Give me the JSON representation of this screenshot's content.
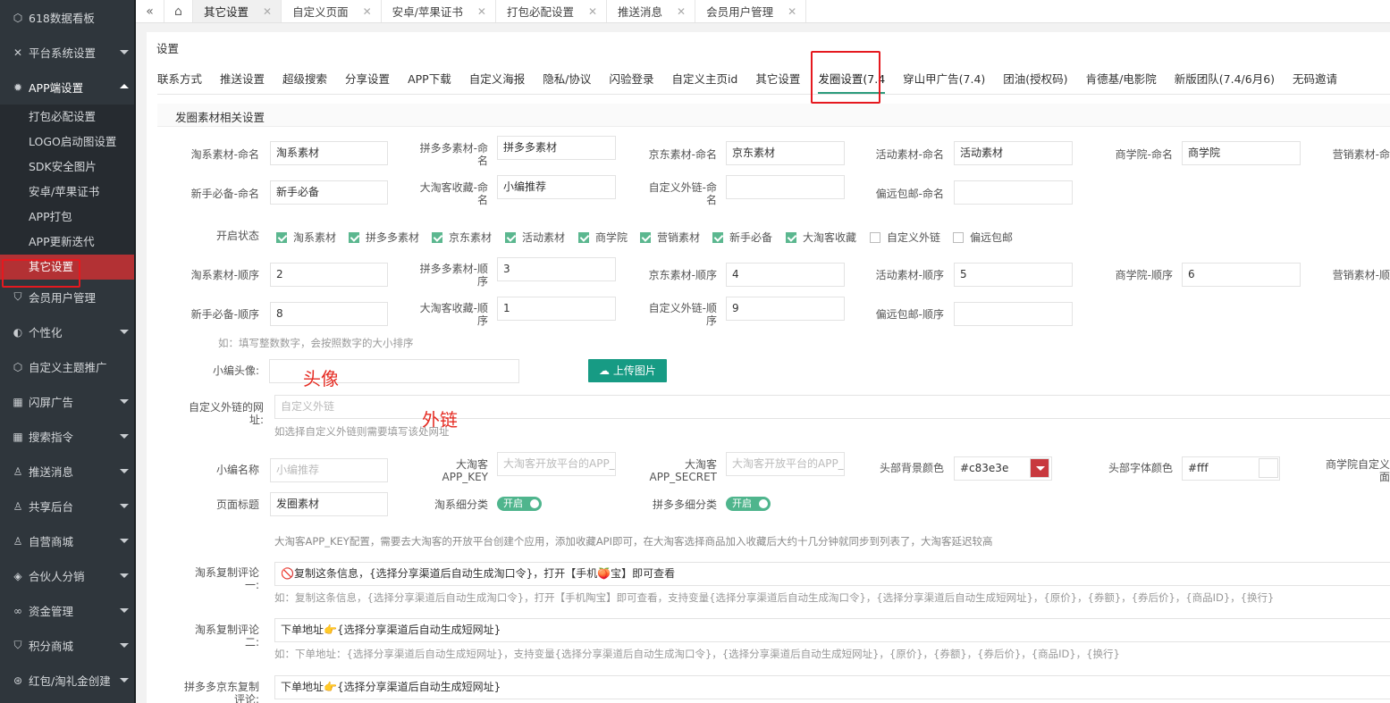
{
  "sidebar": {
    "items": [
      {
        "icon": "cube-icon",
        "label": "618数据看板",
        "caret": false
      },
      {
        "icon": "tools-icon",
        "label": "平台系统设置",
        "caret": true
      },
      {
        "icon": "gear-icon",
        "label": "APP端设置",
        "caret": true,
        "open": true
      },
      {
        "icon": "shield-icon",
        "label": "会员用户管理",
        "caret": false
      },
      {
        "icon": "palette-icon",
        "label": "个性化",
        "caret": true
      },
      {
        "icon": "cube-icon",
        "label": "自定义主题推广",
        "caret": false
      },
      {
        "icon": "grid-icon",
        "label": "闪屏广告",
        "caret": true
      },
      {
        "icon": "grid-icon",
        "label": "搜索指令",
        "caret": true
      },
      {
        "icon": "user-icon",
        "label": "推送消息",
        "caret": true
      },
      {
        "icon": "user-icon",
        "label": "共享后台",
        "caret": true
      },
      {
        "icon": "user-icon",
        "label": "自营商城",
        "caret": true
      },
      {
        "icon": "layers-icon",
        "label": "合伙人分销",
        "caret": true
      },
      {
        "icon": "link-icon",
        "label": "资金管理",
        "caret": true
      },
      {
        "icon": "shield-icon",
        "label": "积分商城",
        "caret": true
      },
      {
        "icon": "gift-icon",
        "label": "红包/淘礼金创建",
        "caret": true
      }
    ],
    "sub_items": [
      "打包必配设置",
      "LOGO启动图设置",
      "SDK安全图片",
      "安卓/苹果证书",
      "APP打包",
      "APP更新迭代",
      "其它设置"
    ]
  },
  "tabbar": {
    "tabs": [
      "其它设置",
      "自定义页面",
      "安卓/苹果证书",
      "打包必配设置",
      "推送消息",
      "会员用户管理"
    ],
    "active": 0
  },
  "panel": {
    "title": "设置",
    "subtabs": [
      "联系方式",
      "推送设置",
      "超级搜索",
      "分享设置",
      "APP下载",
      "自定义海报",
      "隐私/协议",
      "闪验登录",
      "自定义主页id",
      "其它设置",
      "发圈设置(7.4",
      "穿山甲广告(7.4)",
      "团油(授权码)",
      "肯德基/电影院",
      "新版团队(7.4/6月6)",
      "无码邀请"
    ],
    "active_subtab": 10,
    "section_title": "发圈素材相关设置"
  },
  "form": {
    "names": [
      {
        "label": "淘系素材-命名",
        "value": "淘系素材"
      },
      {
        "label": "拼多多素材-命名",
        "value": "拼多多素材"
      },
      {
        "label": "京东素材-命名",
        "value": "京东素材"
      },
      {
        "label": "活动素材-命名",
        "value": "活动素材"
      },
      {
        "label": "商学院-命名",
        "value": "商学院"
      },
      {
        "label": "营销素材-命",
        "value": ""
      },
      {
        "label": "新手必备-命名",
        "value": "新手必备"
      },
      {
        "label": "大淘客收藏-命名",
        "value": "小编推荐"
      },
      {
        "label": "自定义外链-命名",
        "value": ""
      },
      {
        "label": "偏远包邮-命名",
        "value": ""
      }
    ],
    "status_label": "开启状态",
    "checks": [
      {
        "label": "淘系素材",
        "on": true
      },
      {
        "label": "拼多多素材",
        "on": true
      },
      {
        "label": "京东素材",
        "on": true
      },
      {
        "label": "活动素材",
        "on": true
      },
      {
        "label": "商学院",
        "on": true
      },
      {
        "label": "营销素材",
        "on": true
      },
      {
        "label": "新手必备",
        "on": true
      },
      {
        "label": "大淘客收藏",
        "on": true
      },
      {
        "label": "自定义外链",
        "on": false
      },
      {
        "label": "偏远包邮",
        "on": false
      }
    ],
    "orders": [
      {
        "label": "淘系素材-顺序",
        "value": "2"
      },
      {
        "label": "拼多多素材-顺序",
        "value": "3"
      },
      {
        "label": "京东素材-顺序",
        "value": "4"
      },
      {
        "label": "活动素材-顺序",
        "value": "5"
      },
      {
        "label": "商学院-顺序",
        "value": "6"
      },
      {
        "label": "营销素材-顺",
        "value": ""
      },
      {
        "label": "新手必备-顺序",
        "value": "8"
      },
      {
        "label": "大淘客收藏-顺序",
        "value": "1"
      },
      {
        "label": "自定义外链-顺序",
        "value": "9"
      },
      {
        "label": "偏远包邮-顺序",
        "value": ""
      }
    ],
    "order_hint": "如：填写整数数字，会按照数字的大小排序",
    "avatar_label": "小编头像:",
    "avatar_anno": "头像",
    "upload_button": "上传图片",
    "link_label": "自定义外链的网址:",
    "link_placeholder": "自定义外链",
    "link_anno": "外链",
    "link_hint": "如选择自定义外链则需要填写该处网址",
    "editor_label": "小编名称",
    "editor_placeholder": "小编推荐",
    "key_label": "大淘客APP_KEY",
    "key_placeholder": "大淘客开放平台的APP_",
    "secret_label": "大淘客APP_SECRET",
    "secret_placeholder": "大淘客开放平台的APP_",
    "bg_color_label": "头部背景颜色",
    "bg_color_value": "#c83e3e",
    "font_color_label": "头部字体颜色",
    "font_color_value": "#fff",
    "custom_label": "商学院自定义面",
    "page_title_label": "页面标题",
    "page_title_value": "发圈素材",
    "tb_category_label": "淘系细分类",
    "pdd_category_label": "拼多多细分类",
    "switch_on": "开启",
    "key_hint": "大淘客APP_KEY配置，需要去大淘客的开放平台创建个应用，添加收藏API即可，在大淘客选择商品加入收藏后大约十几分钟就同步到列表了，大淘客延迟较高",
    "comment1_label": "淘系复制评论一:",
    "comment1_value": "🚫复制这条信息，{选择分享渠道后自动生成淘口令}，打开【手机🍑宝】即可查看",
    "comment1_hint": "如：复制这条信息，{选择分享渠道后自动生成淘口令}，打开【手机陶宝】即可查看，支持变量{选择分享渠道后自动生成淘口令}，{选择分享渠道后自动生成短网址}，{原价}，{券额}，{券后价}，{商品ID}，{换行}",
    "comment2_label": "淘系复制评论二:",
    "comment2_value": "下单地址👉{选择分享渠道后自动生成短网址}",
    "comment2_hint": "如：下单地址：{选择分享渠道后自动生成短网址}，支持变量{选择分享渠道后自动生成淘口令}，{选择分享渠道后自动生成短网址}，{原价}，{券额}，{券后价}，{商品ID}，{换行}",
    "comment3_label": "拼多多京东复制评论:",
    "comment3_value": "下单地址👉{选择分享渠道后自动生成短网址}"
  }
}
